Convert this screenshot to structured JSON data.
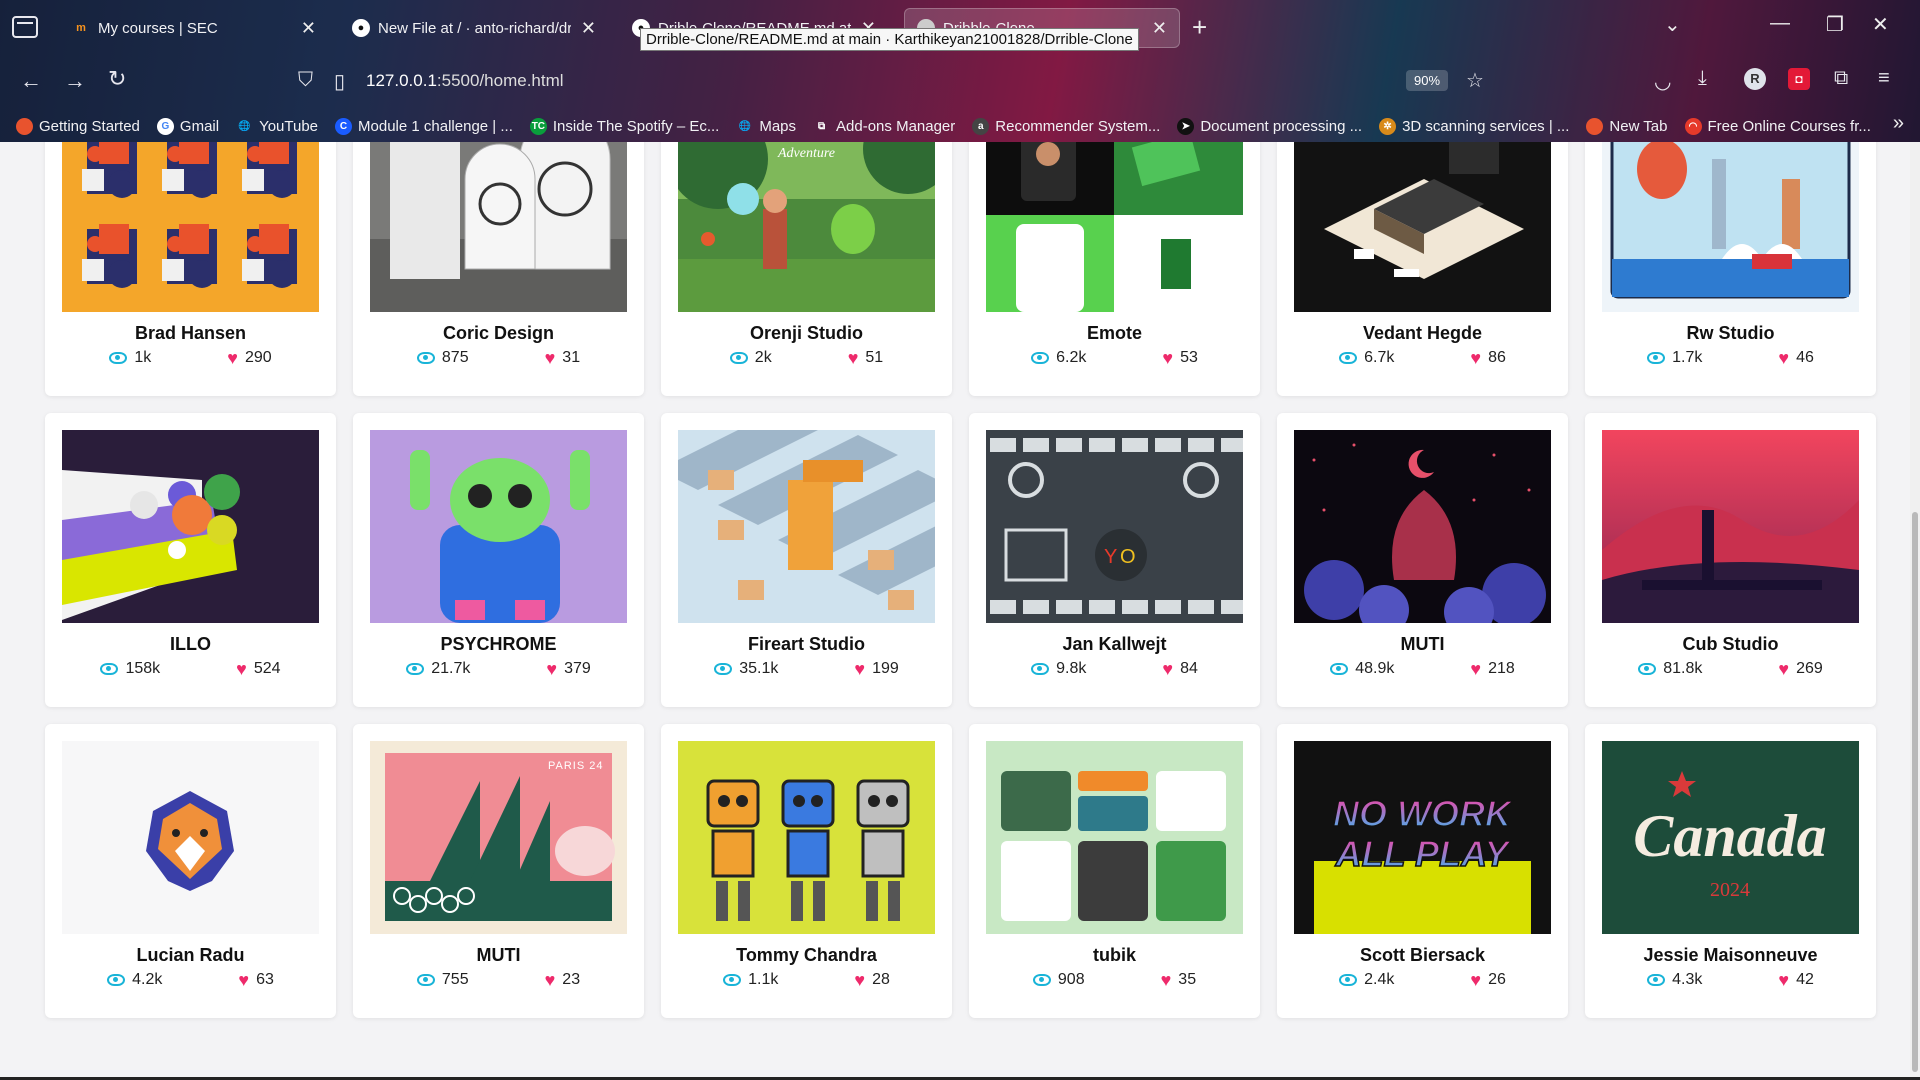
{
  "browser": {
    "tabs": [
      {
        "title": "My courses | SEC",
        "favicon": "moodle-icon",
        "color": "#f7931e",
        "active": false
      },
      {
        "title": "New File at / · anto-richard/drib",
        "favicon": "github-icon",
        "color": "#ffffff",
        "active": false
      },
      {
        "title": "Drible-Clone/README.md at ma",
        "favicon": "github-icon",
        "color": "#ffffff",
        "active": false
      },
      {
        "title": "Dribble-Clone",
        "favicon": "page-icon",
        "color": "#cccccc",
        "active": true
      }
    ],
    "tooltip": "Drrible-Clone/README.md at main · Karthikeyan21001828/Drrible-Clone",
    "url_host": "127.0.0.1",
    "url_path": ":5500/home.html",
    "zoom": "90%",
    "profile_initial": "R",
    "bookmarks": [
      {
        "label": "Getting Started",
        "icon": "firefox-icon",
        "color": "#e8532e",
        "glyph": ""
      },
      {
        "label": "Gmail",
        "icon": "google-icon",
        "color": "#ffffff",
        "glyph": "G"
      },
      {
        "label": "YouTube",
        "icon": "globe-icon",
        "color": "transparent",
        "glyph": "🌐"
      },
      {
        "label": "Module 1 challenge | ...",
        "icon": "c-icon",
        "color": "#1a5cff",
        "glyph": "C"
      },
      {
        "label": "Inside The Spotify – Ec...",
        "icon": "tc-icon",
        "color": "#0a9e3c",
        "glyph": "TC"
      },
      {
        "label": "Maps",
        "icon": "globe-icon",
        "color": "transparent",
        "glyph": "🌐"
      },
      {
        "label": "Add-ons Manager",
        "icon": "puzzle-icon",
        "color": "transparent",
        "glyph": "⧉"
      },
      {
        "label": "Recommender System...",
        "icon": "aws-icon",
        "color": "#444444",
        "glyph": "a"
      },
      {
        "label": "Document processing ...",
        "icon": "arrow-icon",
        "color": "#111111",
        "glyph": "➤"
      },
      {
        "label": "3D scanning services | ...",
        "icon": "gear-icon",
        "color": "#d88a1a",
        "glyph": "✲"
      },
      {
        "label": "New Tab",
        "icon": "firefox-icon",
        "color": "#e8532e",
        "glyph": ""
      },
      {
        "label": "Free Online Courses fr...",
        "icon": "rainbow-icon",
        "color": "#e63a2a",
        "glyph": "◠"
      }
    ]
  },
  "shots": [
    {
      "name": "Brad Hansen",
      "views": "1k",
      "likes": "290",
      "art": "iso-shapes"
    },
    {
      "name": "Coric Design",
      "views": "875",
      "likes": "31",
      "art": "signs"
    },
    {
      "name": "Orenji Studio",
      "views": "2k",
      "likes": "51",
      "art": "forest"
    },
    {
      "name": "Emote",
      "views": "6.2k",
      "likes": "53",
      "art": "app-green"
    },
    {
      "name": "Vedant Hegde",
      "views": "6.7k",
      "likes": "86",
      "art": "iso-house"
    },
    {
      "name": "Rw Studio",
      "views": "1.7k",
      "likes": "46",
      "art": "city"
    },
    {
      "name": "ILLO",
      "views": "158k",
      "likes": "524",
      "art": "illo"
    },
    {
      "name": "PSYCHROME",
      "views": "21.7k",
      "likes": "379",
      "art": "cat"
    },
    {
      "name": "Fireart Studio",
      "views": "35.1k",
      "likes": "199",
      "art": "factory"
    },
    {
      "name": "Jan Kallwejt",
      "views": "9.8k",
      "likes": "84",
      "art": "pattern"
    },
    {
      "name": "MUTI",
      "views": "48.9k",
      "likes": "218",
      "art": "night"
    },
    {
      "name": "Cub Studio",
      "views": "81.8k",
      "likes": "269",
      "art": "pink-land"
    },
    {
      "name": "Lucian Radu",
      "views": "4.2k",
      "likes": "63",
      "art": "lion"
    },
    {
      "name": "MUTI",
      "views": "755",
      "likes": "23",
      "art": "paris",
      "art_text": "PARIS 24"
    },
    {
      "name": "Tommy Chandra",
      "views": "1.1k",
      "likes": "28",
      "art": "robots"
    },
    {
      "name": "tubik",
      "views": "908",
      "likes": "35",
      "art": "dashboard"
    },
    {
      "name": "Scott Biersack",
      "views": "2.4k",
      "likes": "26",
      "art": "nowork",
      "art_text": "NO WORK ALL PLAY"
    },
    {
      "name": "Jessie Maisonneuve",
      "views": "4.3k",
      "likes": "42",
      "art": "canada",
      "art_text": "Canada",
      "art_year": "2024"
    }
  ]
}
